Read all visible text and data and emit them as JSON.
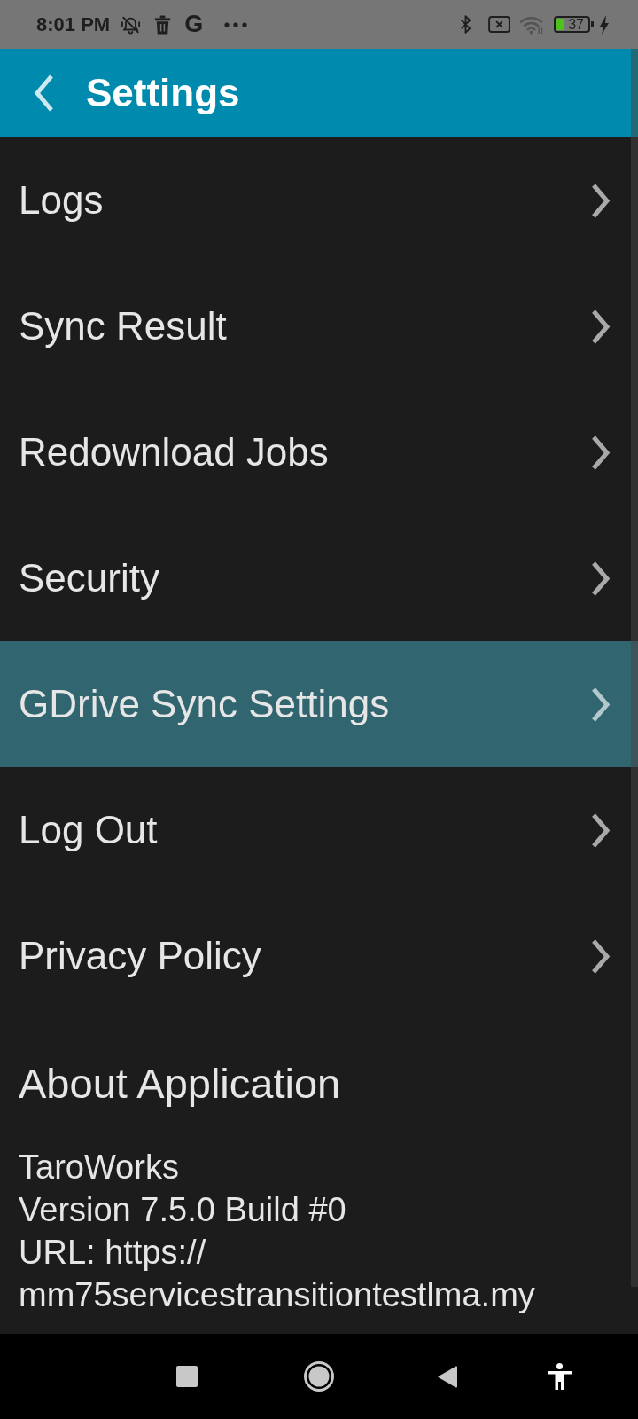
{
  "status_bar": {
    "time": "8:01 PM",
    "notification_badge": "G",
    "battery": "37"
  },
  "app_bar": {
    "title": "Settings"
  },
  "menu": [
    {
      "label": "Logs",
      "selected": false
    },
    {
      "label": "Sync Result",
      "selected": false
    },
    {
      "label": "Redownload Jobs",
      "selected": false
    },
    {
      "label": "Security",
      "selected": false
    },
    {
      "label": "GDrive Sync Settings",
      "selected": true
    },
    {
      "label": "Log Out",
      "selected": false
    },
    {
      "label": "Privacy Policy",
      "selected": false
    }
  ],
  "about": {
    "heading": "About Application",
    "lines": [
      "TaroWorks",
      "Version 7.5.0 Build #0",
      "URL: https://",
      "mm75servicestransitiontestlma.my"
    ]
  }
}
